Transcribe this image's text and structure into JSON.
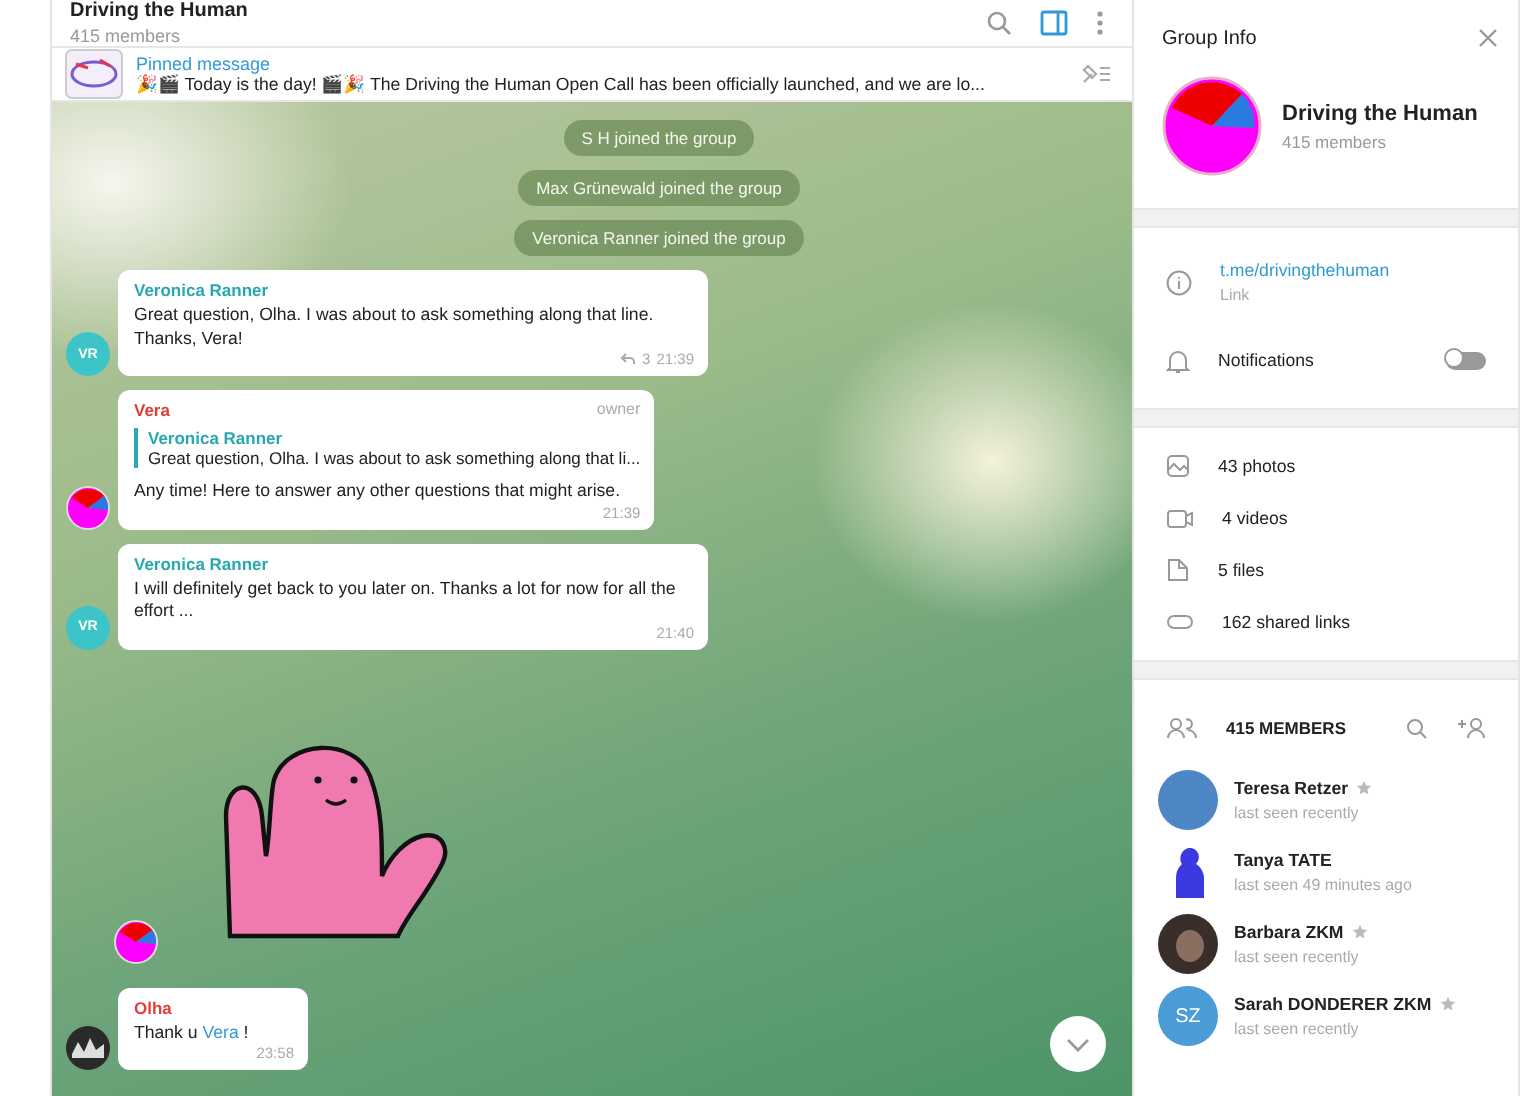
{
  "chat": {
    "title": "Driving the Human",
    "subtitle": "415 members",
    "pinned": {
      "label": "Pinned message",
      "text": "🎉🎬 Today is the day! 🎬🎉 The Driving the Human Open Call has been officially launched, and we are lo..."
    },
    "messages": [
      {
        "kind": "service",
        "text": "S H joined the group"
      },
      {
        "kind": "service",
        "text": "Max Grünewald joined the group"
      },
      {
        "kind": "service",
        "text": "Veronica Ranner joined the group"
      },
      {
        "kind": "text",
        "avatar": {
          "kind": "initials",
          "text": "VR",
          "color": "#3cc4c8"
        },
        "sender": "Veronica Ranner",
        "color": "#2aa8b0",
        "text": "Great question, Olha. I was about to ask something along that line. Thanks, Vera!",
        "replies": "3",
        "time": "21:39"
      },
      {
        "kind": "reply",
        "avatar": {
          "kind": "pie"
        },
        "sender": "Vera",
        "color": "#e0403a",
        "role": "owner",
        "reply": {
          "sender": "Veronica Ranner",
          "text": "Great question, Olha. I was about to ask something along that li..."
        },
        "text": "Any time! Here to answer any other questions that might arise.",
        "time": "21:39"
      },
      {
        "kind": "text",
        "avatar": {
          "kind": "initials",
          "text": "VR",
          "color": "#3cc4c8"
        },
        "sender": "Veronica Ranner",
        "color": "#2aa8b0",
        "text": "I will definitely get back to you later on. Thanks a lot for now for all the effort ...",
        "time": "21:40"
      },
      {
        "kind": "sticker",
        "avatar": {
          "kind": "pie"
        }
      },
      {
        "kind": "text",
        "avatar": {
          "kind": "photo"
        },
        "sender": "Olha",
        "color": "#e0403a",
        "parts": [
          {
            "kind": "plain",
            "text": "Thank u "
          },
          {
            "kind": "mention",
            "text": "Vera"
          },
          {
            "kind": "plain",
            "text": " !"
          }
        ],
        "time": "23:58"
      }
    ]
  },
  "info": {
    "title": "Group Info",
    "name": "Driving the Human",
    "members_count": "415 members",
    "link": {
      "value": "t.me/drivingthehuman",
      "label": "Link"
    },
    "notifications": {
      "label": "Notifications",
      "on": false
    },
    "media": [
      {
        "kind": "photos",
        "text": "43 photos"
      },
      {
        "kind": "videos",
        "text": "4 videos"
      },
      {
        "kind": "files",
        "text": "5 files"
      },
      {
        "kind": "links",
        "text": "162 shared links"
      }
    ],
    "members_heading": "415 MEMBERS",
    "members": [
      {
        "name": "Teresa Retzer",
        "status": "last seen recently",
        "admin": true,
        "avatar": {
          "kind": "plain",
          "color": "#4f86c6"
        }
      },
      {
        "name": "Tanya TATE",
        "status": "last seen 49 minutes ago",
        "admin": false,
        "avatar": {
          "kind": "figure",
          "color": "#3a3ae0"
        }
      },
      {
        "name": "Barbara ZKM",
        "status": "last seen recently",
        "admin": true,
        "avatar": {
          "kind": "photo"
        }
      },
      {
        "name": "Sarah DONDERER ZKM",
        "status": "last seen recently",
        "admin": true,
        "avatar": {
          "kind": "initials",
          "text": "SZ",
          "color": "#4a9bd6"
        }
      }
    ]
  }
}
